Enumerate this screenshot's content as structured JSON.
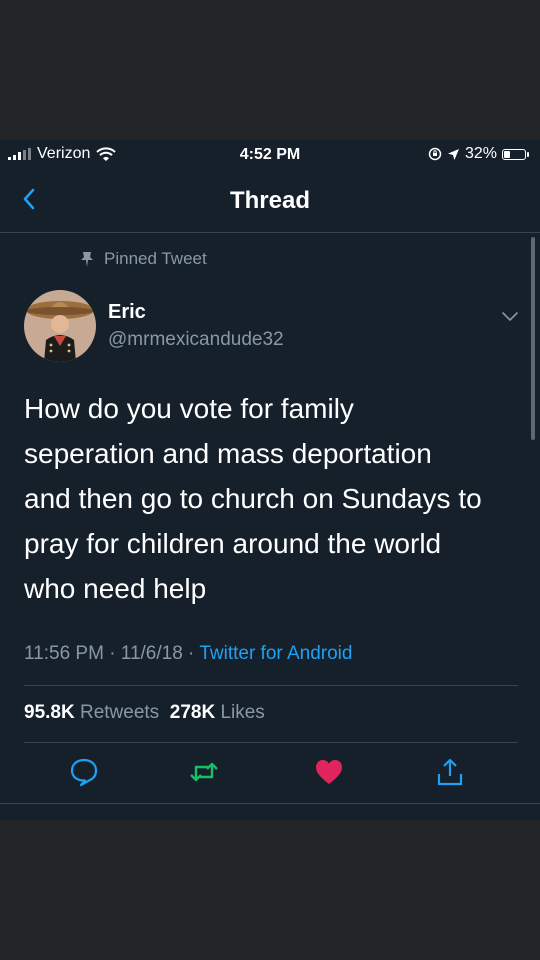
{
  "status_bar": {
    "carrier": "Verizon",
    "time": "4:52 PM",
    "battery": "32%",
    "battery_level": 0.32
  },
  "header": {
    "title": "Thread"
  },
  "tweet": {
    "pinned_label": "Pinned Tweet",
    "author_name": "Eric",
    "author_handle": "@mrmexicandude32",
    "text_lines": [
      "How do you vote for family",
      "seperation and mass deportation",
      "and then go to church on Sundays to",
      "pray for children around the world",
      "who need help"
    ],
    "timestamp": "11:56 PM · 11/6/18 · ",
    "source": "Twitter for Android",
    "retweets_count": "95.8K",
    "retweets_label": "Retweets",
    "likes_count": "278K",
    "likes_label": "Likes"
  },
  "icons": [
    "signal-icon",
    "wifi-icon",
    "rotation-lock-icon",
    "location-arrow-icon",
    "battery-icon",
    "back-chevron-icon",
    "pin-icon",
    "chevron-down-icon",
    "reply-icon",
    "retweet-icon",
    "like-heart-icon",
    "share-icon"
  ],
  "colors": {
    "background": "#15202b",
    "secondary_text": "#8899a6",
    "link": "#1da1f2",
    "retweet": "#17bf63",
    "like": "#e0245e"
  }
}
